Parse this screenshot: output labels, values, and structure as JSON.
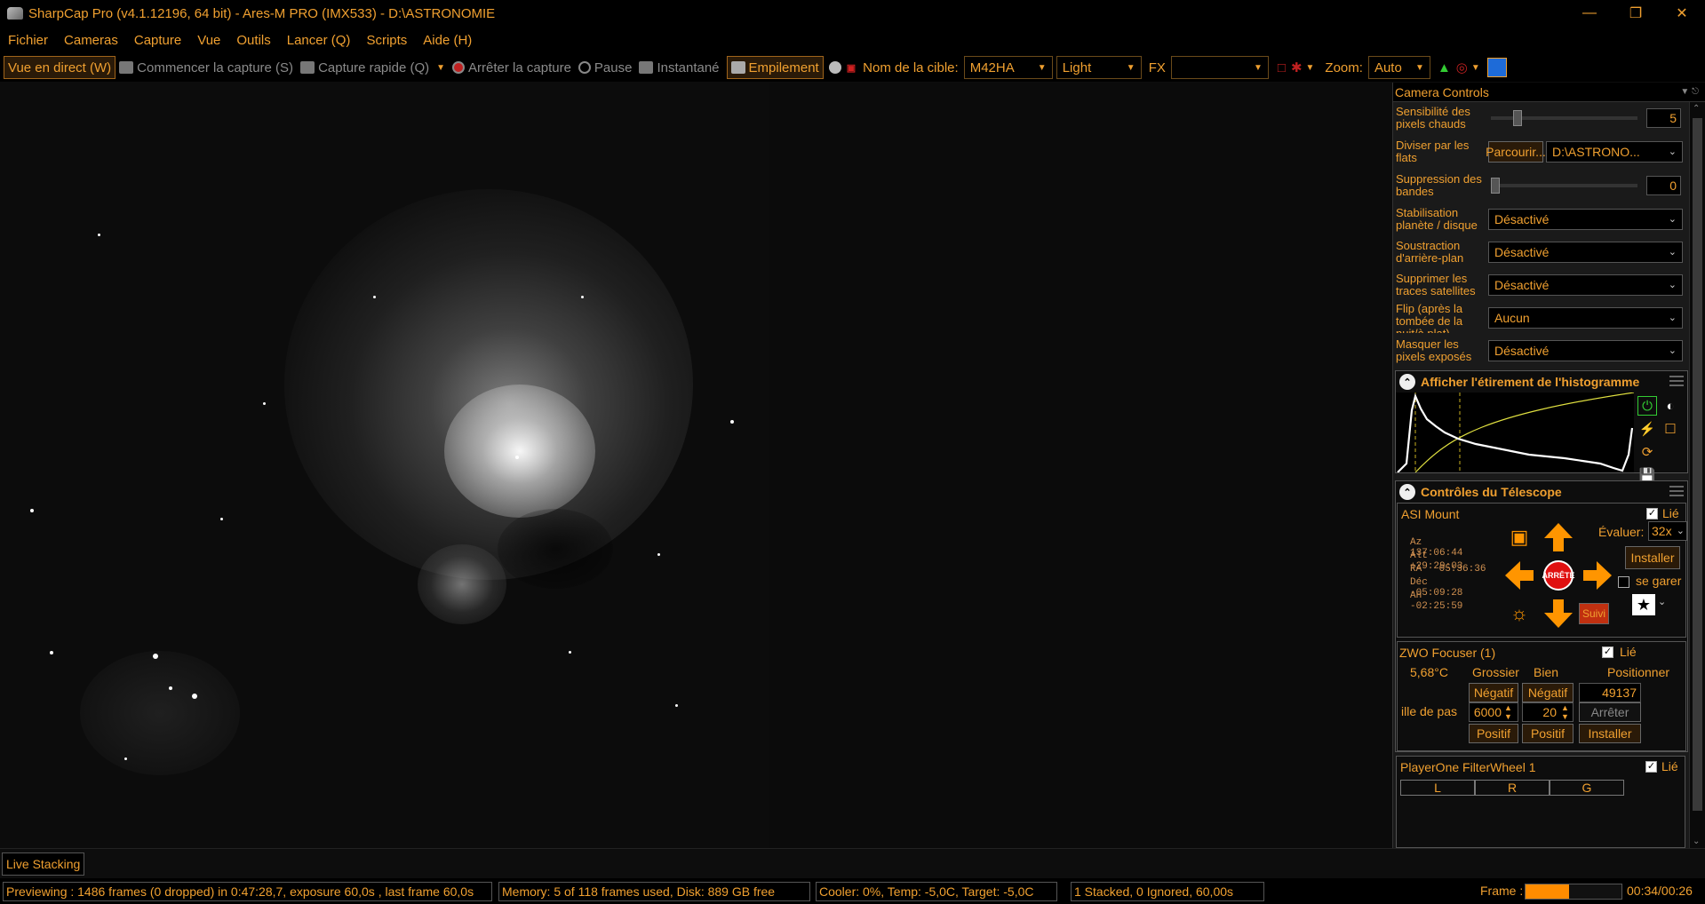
{
  "window": {
    "title": "SharpCap Pro (v4.1.12196, 64 bit) - Ares-M PRO (IMX533) - D:\\ASTRONOMIE",
    "minimize_icon": "minimize-icon",
    "restore_icon": "restore-icon",
    "close_icon": "close-icon"
  },
  "menu": [
    "Fichier",
    "Cameras",
    "Capture",
    "Vue",
    "Outils",
    "Lancer (Q)",
    "Scripts",
    "Aide (H)"
  ],
  "toolbar": {
    "live_view": "Vue en direct (W)",
    "start_capture": "Commencer la capture (S)",
    "quick_capture": "Capture rapide (Q)",
    "stop_capture": "Arrêter la capture",
    "pause": "Pause",
    "snapshot": "Instantané",
    "stacking": "Empilement",
    "target_label": "Nom de la cible:",
    "target_value": "M42HA",
    "frame_type": "Light",
    "fx_label": "FX",
    "fx_value": "",
    "zoom_label": "Zoom:",
    "zoom_value": "Auto"
  },
  "camera_controls": {
    "header": "Camera Controls",
    "hot_pixel": {
      "label": "Sensibilité des pixels chauds",
      "value": "5",
      "level": 0.15
    },
    "flat": {
      "label": "Diviser par les flats",
      "browse": "Parcourir...",
      "path": "D:\\ASTRONO..."
    },
    "banding": {
      "label": "Suppression des bandes",
      "value": "0",
      "level": 0.0
    },
    "stabilisation": {
      "label": "Stabilisation planète / disque",
      "value": "Désactivé"
    },
    "background": {
      "label": "Soustraction d'arrière-plan",
      "value": "Désactivé"
    },
    "satellites": {
      "label": "Supprimer les traces satellites",
      "value": "Désactivé"
    },
    "flip": {
      "label": "Flip (après la tombée de la nuit/à plat)",
      "value": "Aucun"
    },
    "mask": {
      "label": "Masquer les pixels exposés",
      "value": "Désactivé"
    }
  },
  "histogram": {
    "title": "Afficher l'étirement de l'histogramme"
  },
  "telescope": {
    "title": "Contrôles du Télescope",
    "mount_name": "ASI Mount",
    "linked_label": "Lié",
    "rate_label": "Évaluer:",
    "rate_value": "32x",
    "install": "Installer",
    "park": "se garer",
    "stop": "ARRÊTE",
    "tracking": "Suivi",
    "coords": [
      {
        "k": "Az",
        "v": "137:06:44"
      },
      {
        "k": "Alt",
        "v": "+29:29:03"
      },
      {
        "k": "RA",
        "v": "05:36:36"
      },
      {
        "k": "Déc",
        "v": "-05:09:28"
      },
      {
        "k": "AH",
        "v": "-02:25:59"
      }
    ]
  },
  "focuser": {
    "name": "ZWO Focuser (1)",
    "linked_label": "Lié",
    "temp": "5,68°C",
    "coarse": "Grossier",
    "fine": "Bien",
    "position_label": "Positionner",
    "negative": "Négatif",
    "negative2": "Négatif",
    "position_value": "49137",
    "step_label": "ille de pas",
    "coarse_step": "6000",
    "fine_step": "20",
    "stop": "Arrêter",
    "positive": "Positif",
    "positive2": "Positif",
    "install": "Installer"
  },
  "filterwheel": {
    "name": "PlayerOne FilterWheel 1",
    "linked_label": "Lié",
    "filters": [
      "L",
      "R",
      "G"
    ]
  },
  "tabs": {
    "live_stacking": "Live Stacking"
  },
  "status": {
    "previewing": "Previewing : 1486 frames (0 dropped) in 0:47:28,7, exposure 60,0s , last frame 60,0s",
    "memory": "Memory: 5 of 118 frames used, Disk: 889 GB free",
    "cooler": "Cooler: 0%, Temp: -5,0C, Target: -5,0C",
    "stacked": "1 Stacked, 0 Ignored, 60,00s",
    "frame_label": "Frame :",
    "frame_progress": 0.45,
    "frame_time": "00:34/00:26"
  },
  "colors": {
    "accent": "#f0a030",
    "background": "#0d0d0d",
    "stop_red": "#e01010",
    "arrow_orange": "#ff9500"
  }
}
